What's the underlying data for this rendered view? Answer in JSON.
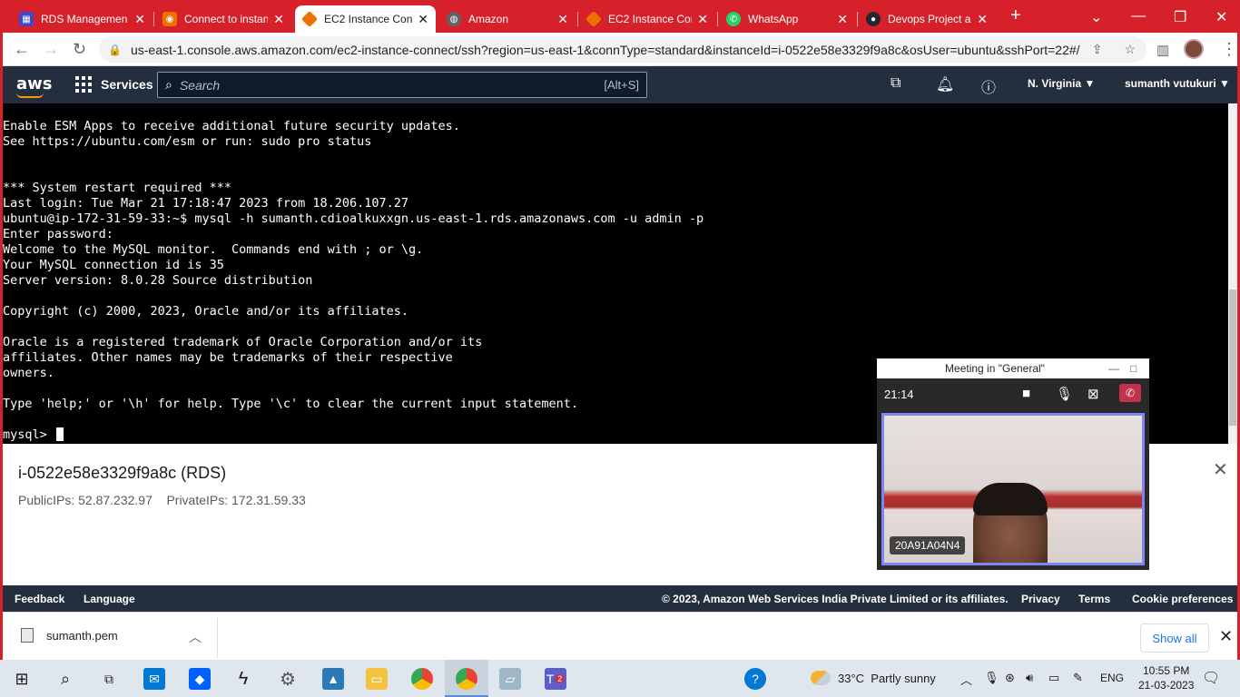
{
  "browser": {
    "tabs": [
      {
        "label": "RDS Managemen",
        "favicon": "rds-icon",
        "color": "#3f48cc"
      },
      {
        "label": "Connect to instan",
        "favicon": "aws-icon",
        "color": "#ed7100"
      },
      {
        "label": "EC2 Instance Con",
        "favicon": "ec2-icon",
        "color": "#ed7100"
      },
      {
        "label": "Amazon",
        "favicon": "globe-icon",
        "color": "#5f6368"
      },
      {
        "label": "EC2 Instance Con",
        "favicon": "ec2-icon",
        "color": "#ed7100"
      },
      {
        "label": "WhatsApp",
        "favicon": "whatsapp-icon",
        "color": "#25d366"
      },
      {
        "label": "Devops Project a",
        "favicon": "github-icon",
        "color": "#24292f"
      }
    ],
    "url": "us-east-1.console.aws.amazon.com/ec2-instance-connect/ssh?region=us-east-1&connType=standard&instanceId=i-0522e58e3329f9a8c&osUser=ubuntu&sshPort=22#/"
  },
  "aws": {
    "logo": "aws",
    "services_label": "Services",
    "search_placeholder": "Search",
    "search_hint": "[Alt+S]",
    "region": "N. Virginia ▼",
    "user": "sumanth vutukuri ▼"
  },
  "terminal": {
    "lines": [
      "Enable ESM Apps to receive additional future security updates.",
      "See https://ubuntu.com/esm or run: sudo pro status",
      "",
      "",
      "*** System restart required ***",
      "Last login: Tue Mar 21 17:18:47 2023 from 18.206.107.27",
      "ubuntu@ip-172-31-59-33:~$ mysql -h sumanth.cdioalkuxxgn.us-east-1.rds.amazonaws.com -u admin -p",
      "Enter password:",
      "Welcome to the MySQL monitor.  Commands end with ; or \\g.",
      "Your MySQL connection id is 35",
      "Server version: 8.0.28 Source distribution",
      "",
      "Copyright (c) 2000, 2023, Oracle and/or its affiliates.",
      "",
      "Oracle is a registered trademark of Oracle Corporation and/or its",
      "affiliates. Other names may be trademarks of their respective",
      "owners.",
      "",
      "Type 'help;' or '\\h' for help. Type '\\c' to clear the current input statement.",
      ""
    ],
    "prompt": "mysql> "
  },
  "instance": {
    "title": "i-0522e58e3329f9a8c (RDS)",
    "ips": "PublicIPs: 52.87.232.97    PrivateIPs: 172.31.59.33"
  },
  "footer": {
    "feedback": "Feedback",
    "language": "Language",
    "copyright": "© 2023, Amazon Web Services India Private Limited or its affiliates.",
    "privacy": "Privacy",
    "terms": "Terms",
    "cookies": "Cookie preferences"
  },
  "download": {
    "file": "sumanth.pem",
    "show_all": "Show all"
  },
  "meeting": {
    "title": "Meeting in \"General\"",
    "time": "21:14",
    "participant": "20A91A04N4"
  },
  "taskbar": {
    "weather": "33°C  Partly sunny",
    "lang": "ENG",
    "time": "10:55 PM",
    "date": "21-03-2023",
    "teams_badge": "2"
  }
}
